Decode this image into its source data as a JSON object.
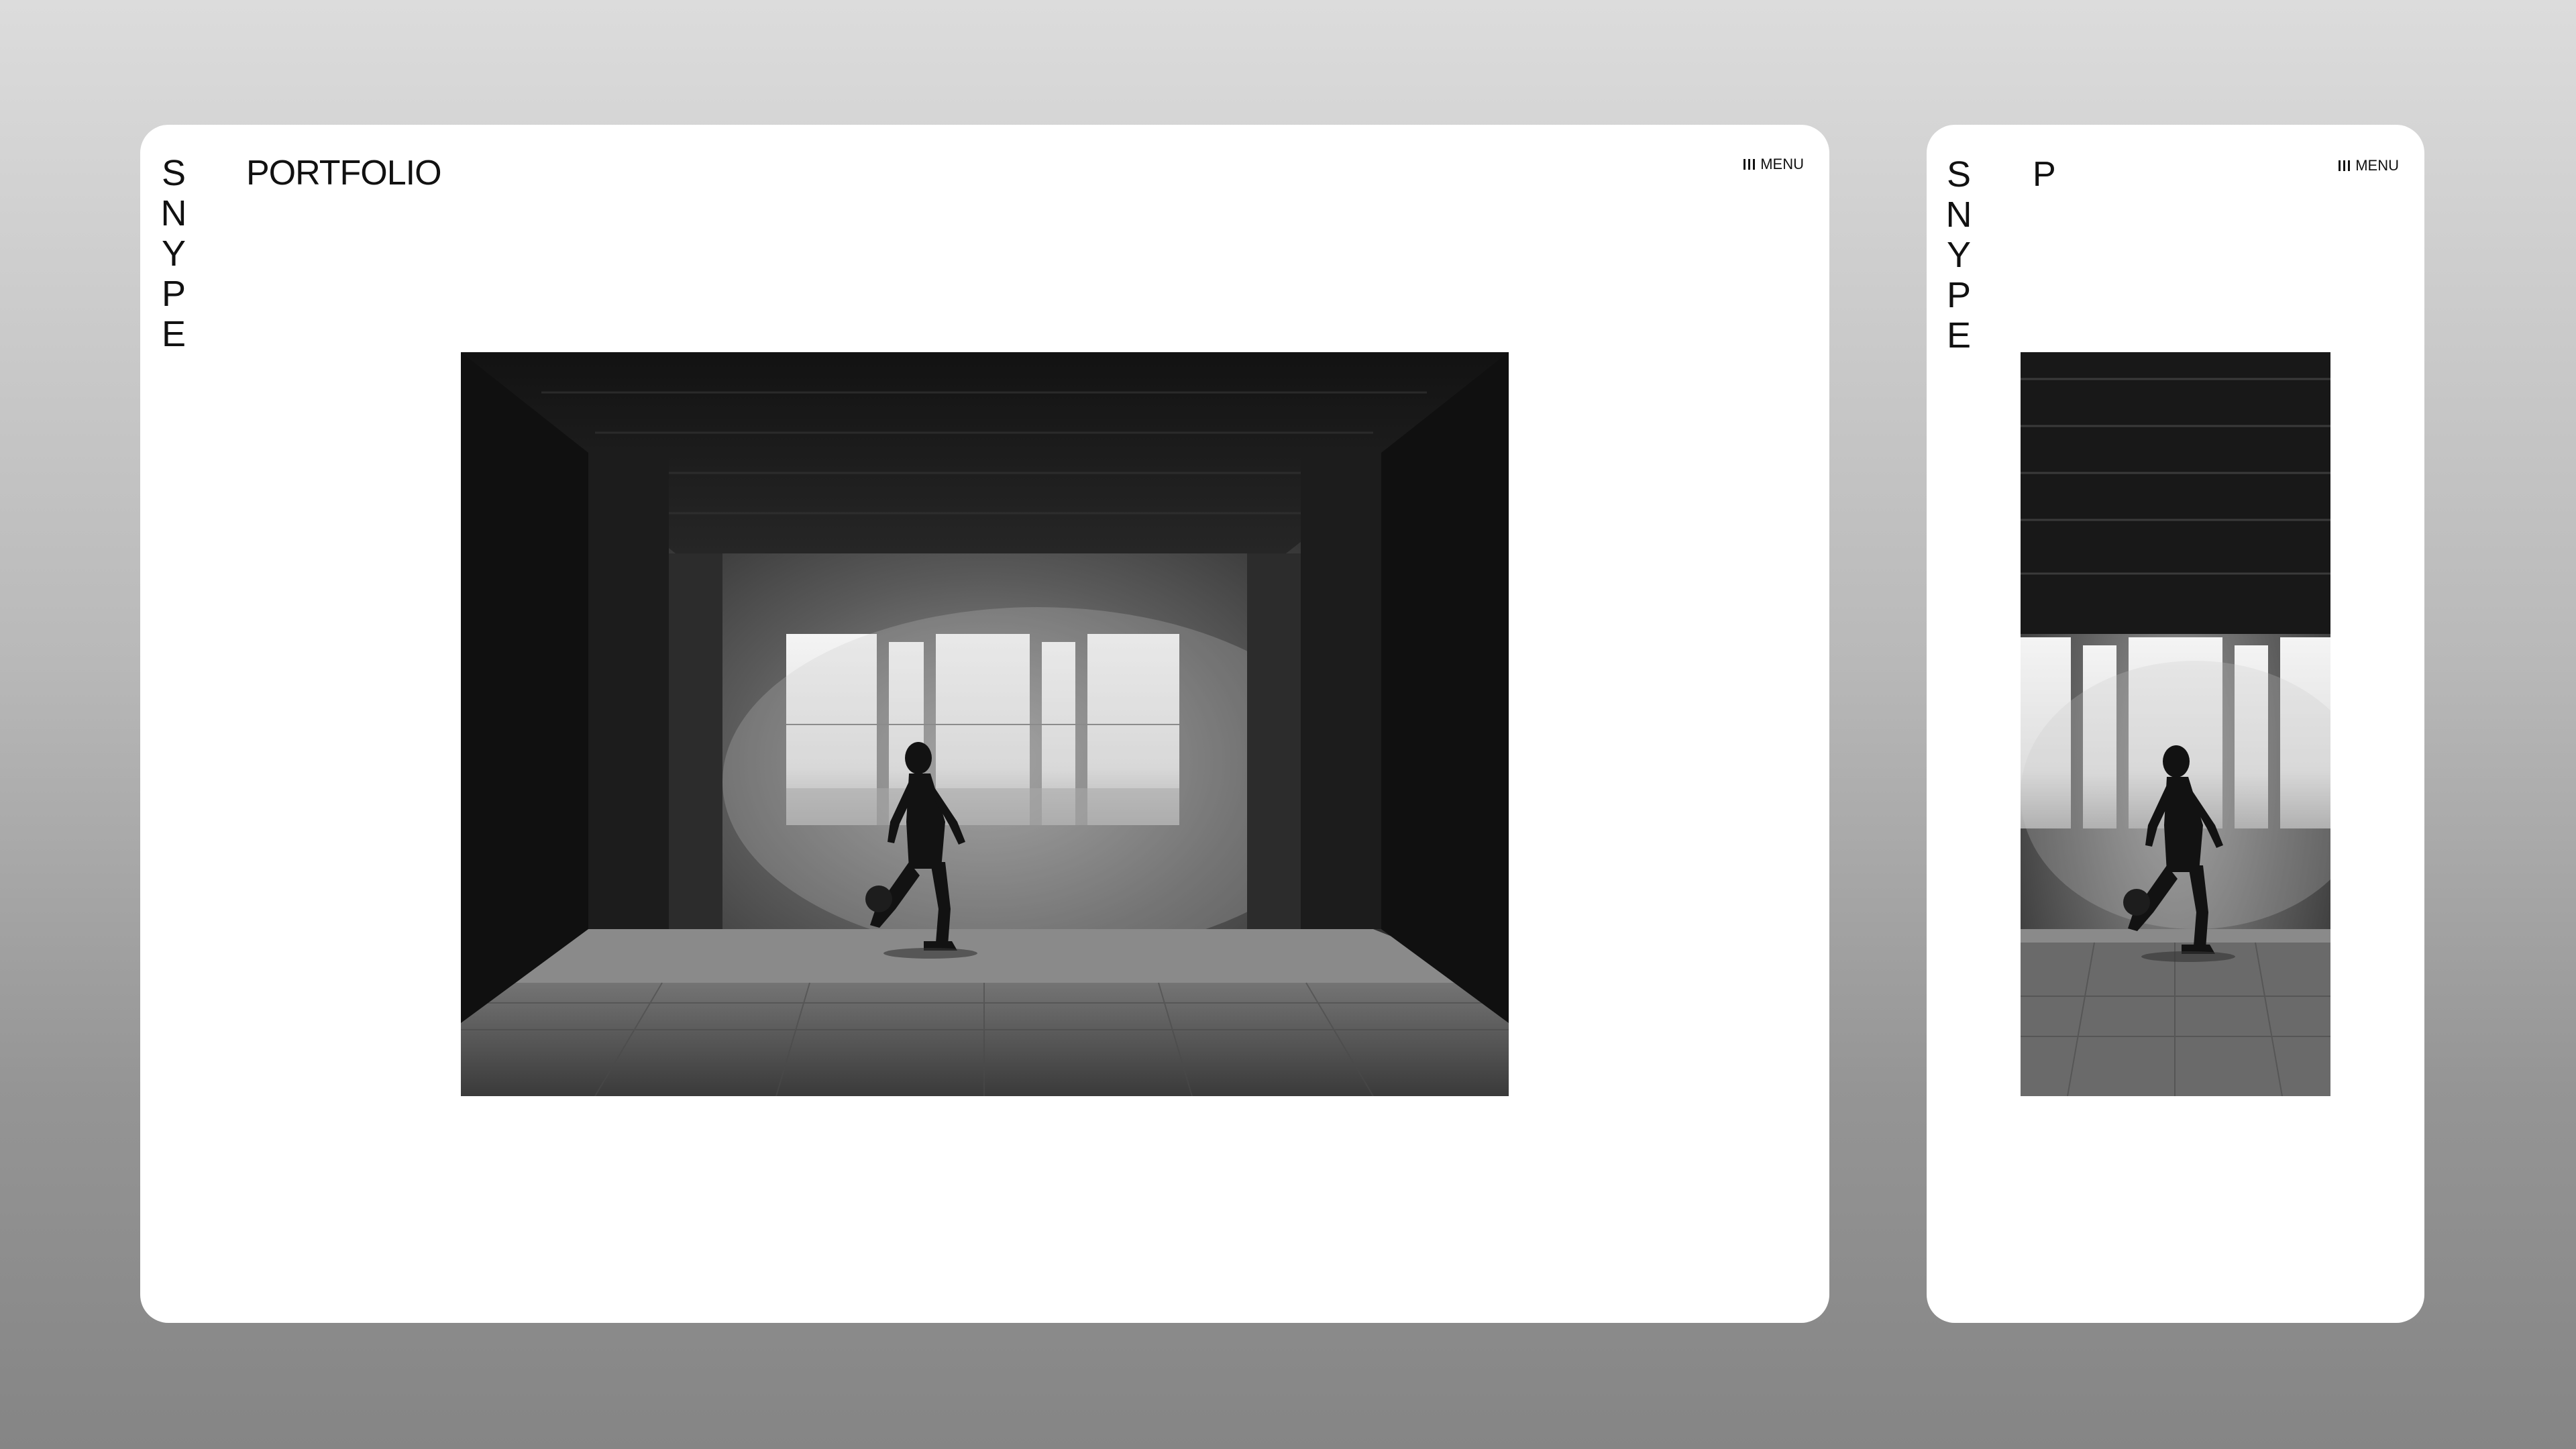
{
  "desktop": {
    "logo_letters": [
      "S",
      "N",
      "Y",
      "P",
      "E"
    ],
    "title": "PORTFOLIO",
    "menu_label": "MENU",
    "menu_icon": "three-bars-icon",
    "photo_icon": "soccer-player-silhouette-photo"
  },
  "mobile": {
    "logo_letters": [
      "S",
      "N",
      "Y",
      "P",
      "E"
    ],
    "title": "P",
    "menu_label": "MENU",
    "menu_icon": "three-bars-icon",
    "photo_icon": "soccer-player-silhouette-photo"
  },
  "colors": {
    "card": "#ffffff",
    "text": "#111111",
    "background_top": "#dcdcdc",
    "background_bottom": "#858585"
  }
}
